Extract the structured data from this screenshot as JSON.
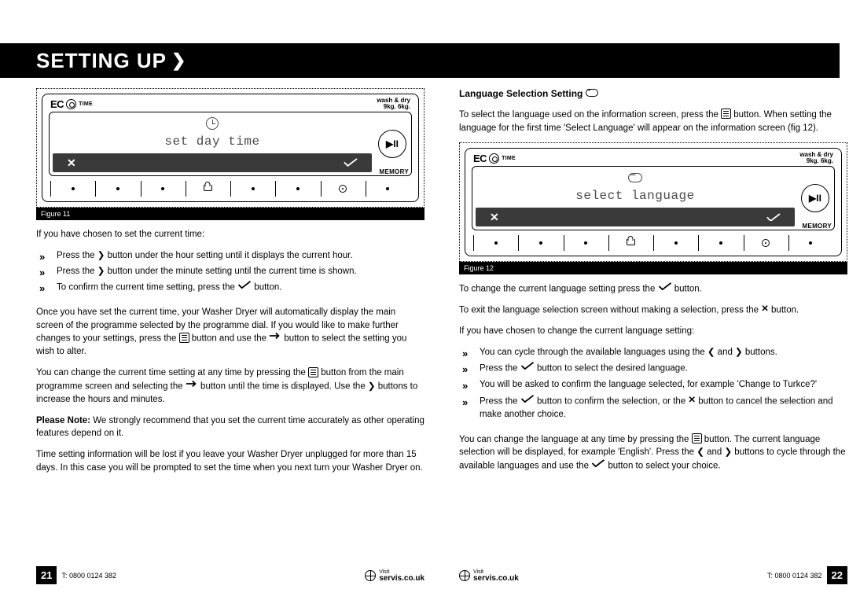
{
  "header": {
    "title": "SETTING UP"
  },
  "figure11": {
    "eco": "EC",
    "time_lbl": "TIME",
    "wash_dry": "wash & dry",
    "weights": "9kg.    6kg.",
    "screen_text": "set day time",
    "play": "▶II",
    "memory": "MEMORY",
    "caption": "Figure 11"
  },
  "figure12": {
    "eco": "EC",
    "time_lbl": "TIME",
    "wash_dry": "wash & dry",
    "weights": "9kg.    6kg.",
    "screen_text": "select language",
    "play": "▶II",
    "memory": "MEMORY",
    "caption": "Figure 12"
  },
  "left": {
    "p1": "If you have chosen to set the current time:",
    "b1": "Press the ❯ button under the hour setting until it displays the current hour.",
    "b2": "Press the ❯ button under the minute setting until the current time is shown.",
    "b3_a": "To confirm the current time setting, press the ",
    "b3_b": " button.",
    "p2_a": "Once you have set the current time, your Washer Dryer will automatically display the main screen of the programme selected by the programme dial. If you would like to make further changes to your settings, press the ",
    "p2_b": " button and use the ",
    "p2_c": " button to select the setting you wish to alter.",
    "p3_a": "You can change the current time setting at any time by pressing the ",
    "p3_b": " button from the main programme screen and selecting the ",
    "p3_c": " button until the time is displayed. Use the ❯ buttons to increase the hours and minutes.",
    "note_label": "Please Note: ",
    "note_text": "We strongly recommend that you set the current time accurately as other operating features depend on it.",
    "p4": "Time setting information will be lost if you leave your Washer Dryer unplugged for more than 15 days. In this case you will be prompted to set the time when you next turn your Washer Dryer on."
  },
  "right": {
    "heading": "Language Selection Setting ",
    "p1_a": "To select the language used on the information screen, press the ",
    "p1_b": " button. When setting the language for the first time 'Select Language' will appear on the information screen (fig 12).",
    "p2_a": "To change the current language setting press the ",
    "p2_b": " button.",
    "p3_a": "To exit the language selection screen without making a selection, press the ",
    "p3_b": " button.",
    "p4": "If you have chosen to change the current language setting:",
    "b1": "You can cycle through the available languages using the ❮ and ❯ buttons.",
    "b2_a": "Press the ",
    "b2_b": " button to select the desired language.",
    "b3": "You will be asked to confirm the language selected, for example 'Change to Turkce?'",
    "b4_a": "Press the ",
    "b4_b": " button to confirm the selection, or the ",
    "b4_c": " button to cancel the selection and make another choice.",
    "p5_a": "You can change the language at any time by pressing the ",
    "p5_b": " button. The current language selection will be displayed, for example 'English'. Press the ❮ and ❯ buttons to cycle through the available languages and use the ",
    "p5_c": " button to select your choice."
  },
  "footer": {
    "page_left": "21",
    "page_right": "22",
    "tel": "T: 0800 0124 382",
    "visit": "Visit",
    "site": "servis.co.uk"
  }
}
